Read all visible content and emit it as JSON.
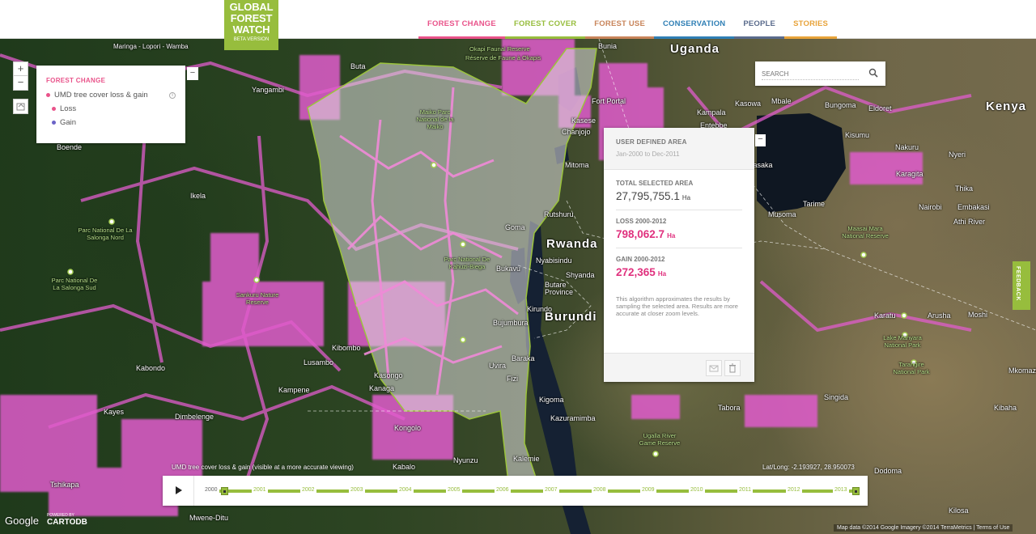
{
  "logo": {
    "line1": "GLOBAL",
    "line2": "FOREST",
    "line3": "WATCH",
    "beta": "BETA VERSION"
  },
  "nav": [
    {
      "label": "FOREST CHANGE",
      "color": "#e9538a"
    },
    {
      "label": "FOREST COVER",
      "color": "#97bd3d"
    },
    {
      "label": "FOREST USE",
      "color": "#c8845a"
    },
    {
      "label": "CONSERVATION",
      "color": "#2f7fb5"
    },
    {
      "label": "PEOPLE",
      "color": "#5a6b8c"
    },
    {
      "label": "STORIES",
      "color": "#e8a33a"
    }
  ],
  "zoom": {
    "in": "+",
    "out": "−"
  },
  "legend": {
    "collapse": "−",
    "title": "FOREST CHANGE",
    "layer": "UMD tree cover loss & gain",
    "layer_color": "#e9538a",
    "info": "i",
    "items": [
      {
        "label": "Loss",
        "color": "#e9538a"
      },
      {
        "label": "Gain",
        "color": "#6b63c7"
      }
    ]
  },
  "search": {
    "placeholder": "SEARCH"
  },
  "analysis": {
    "collapse": "−",
    "title": "USER DEFINED AREA",
    "date_range": "Jan-2000 to Dec-2011",
    "total_label": "TOTAL SELECTED AREA",
    "total_value": "27,795,755.1",
    "loss_label": "LOSS 2000-2012",
    "loss_value": "798,062.7",
    "gain_label": "GAIN 2000-2012",
    "gain_value": "272,365",
    "unit": "Ha",
    "note": "This algorithm approximates the results by sampling the selected area. Results are more accurate at closer zoom levels."
  },
  "feedback": "FEEDBACK",
  "timeline": {
    "years": [
      "2000",
      "2001",
      "2002",
      "2003",
      "2004",
      "2005",
      "2006",
      "2007",
      "2008",
      "2009",
      "2010",
      "2011",
      "2012",
      "2013"
    ],
    "start": "2000",
    "end": "2013"
  },
  "map": {
    "countries": [
      "Uganda",
      "Kenya",
      "Rwanda",
      "Burundi"
    ],
    "places": [
      "Maringa - Lopori - Wamba",
      "Okapi Faunal Reserve",
      "Réserve de Faune à Okapis",
      "Buta",
      "Bunia",
      "Yangambi",
      "Kasese",
      "Fort Portal",
      "Kampala",
      "Entebbe",
      "Kasowa",
      "Mbale",
      "Bungoma",
      "Eldoret",
      "Kisumu",
      "Nakuru",
      "Nyeri",
      "Thika",
      "Nairobi",
      "Embakasi",
      "Athi River",
      "Karagita",
      "Masaka",
      "Musoma",
      "Tarime",
      "Maasai Mara National Reserve",
      "Mitoma",
      "Chanjojo",
      "Rutshuru",
      "Goma",
      "Nyabisindu",
      "Shyanda",
      "Butare Province",
      "Bukavu",
      "Bujumbura",
      "Kigoma",
      "Kazuramimba",
      "Tabora",
      "Singida",
      "Karatu",
      "Arusha",
      "Moshi",
      "Lake Manyara National Park",
      "Tarangire National Park",
      "Ugalla River Game Reserve",
      "Dodoma",
      "Kilosa",
      "Mwene-Ditu",
      "Parc National De Kahuzi-Biega",
      "Parc National De La Salonga Nord",
      "Parc National De La Salonga Sud",
      "Sankuru Nature Reserve",
      "Maiko Parc National de la Maiko",
      "Boende",
      "Ikela",
      "Lusambo",
      "Kalemie",
      "Kasongo",
      "Kibombo",
      "Kabalo",
      "Kongolo",
      "Nyunzu",
      "Dimbelenge",
      "Tshikapa",
      "Kanaga",
      "Kayes",
      "Kabondo",
      "Kampene",
      "Kibaha",
      "Mkomazi",
      "Uvira",
      "Fizi",
      "Baraka",
      "Kirundo"
    ]
  },
  "umd_note": "UMD tree cover loss & gain (visible at a more accurate viewing)",
  "coords": "Lat/Long: -2.193927, 28.950073",
  "attribution": "Map data ©2014 Google Imagery ©2014 TerraMetrics  |  Terms of Use",
  "google": "Google",
  "cartodb": {
    "powered": "POWERED BY",
    "name": "CARTODB"
  }
}
